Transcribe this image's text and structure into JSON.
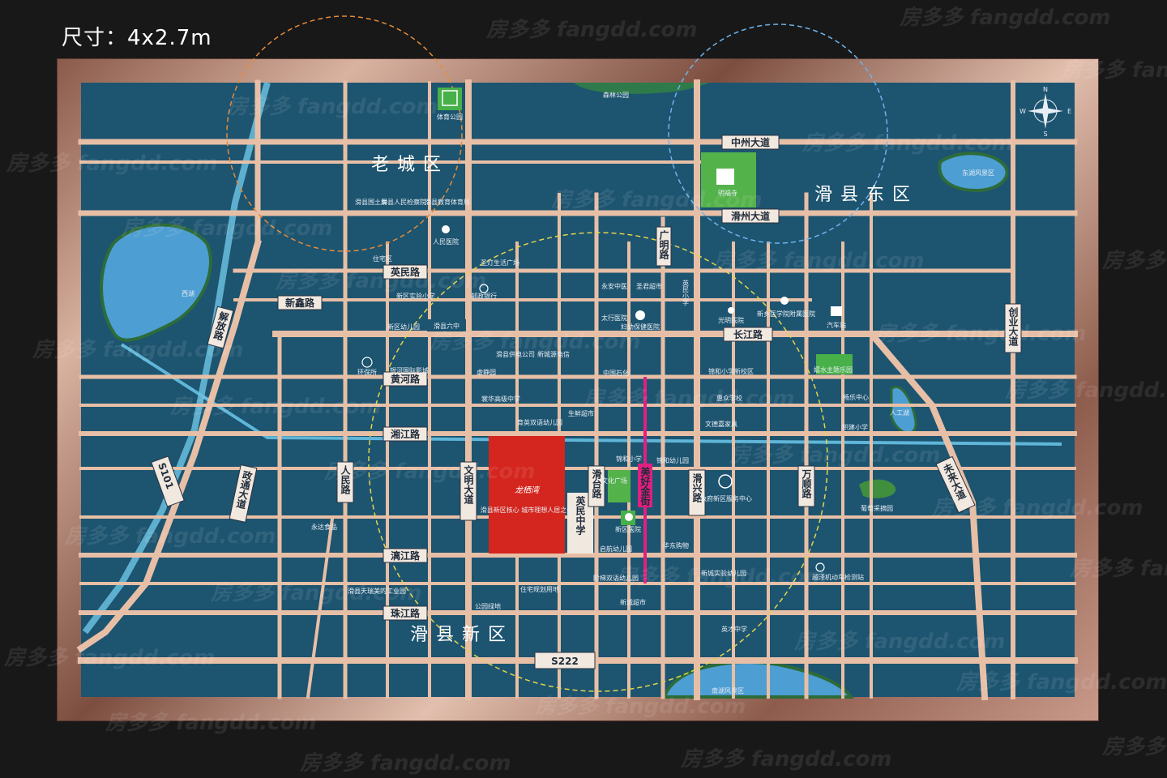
{
  "size_label": "尺寸：4x2.7m",
  "districts": {
    "old_city": "老城区",
    "east": "滑县东区",
    "new": "滑县新区"
  },
  "project": {
    "name": "龙栖湾",
    "tagline": "滑县新区核心 城市理想人居之作",
    "color": "#d4261e"
  },
  "roads": {
    "zhongzhou": "中州大道",
    "huazhou": "滑州大道",
    "yingmin": "英民路",
    "xinxin": "新鑫路",
    "huaxian6": "滑县六中",
    "changjiang": "长江路",
    "huanghe": "黄河路",
    "xiangjiang": "湘江路",
    "lijiang": "漓江路",
    "zhujiang": "珠江路",
    "s222": "S222",
    "s101": "S101",
    "jiefang": "解放路",
    "zhengtong": "政通大道",
    "renmin": "人民路",
    "wenming": "文明大道",
    "huatai": "滑台路",
    "meihao": "美好金街",
    "huaxing": "滑兴路",
    "wanshun": "万顺路",
    "guangming": "广明路",
    "chuangye": "创业大道",
    "weilai": "未来大道",
    "yingminzx": "英民中学",
    "yingmin_xiaoxue": "英民小学"
  },
  "pois": {
    "sports_park": "体育公园",
    "forest_park": "森林公园",
    "mingfu_temple": "明福寺",
    "donghu": "东湖风景区",
    "xihu": "西湖",
    "nanhu": "南湖风景区",
    "land_bureau": "滑县国土局",
    "court": "滑县人民检察院",
    "edu_bureau": "滑县教育体育局",
    "hospital": "人民医院",
    "plaza": "圣灯生活广场",
    "residential": "住宅区",
    "experimental_school": "新区实验小学",
    "bank": "邮政银行",
    "kindergarten": "新区幼儿园",
    "yongan": "永安中医",
    "shengjun": "圣君超市",
    "taihang": "太行医院",
    "maternal": "妇幼保健医院",
    "guangming_hosp": "光明医院",
    "village_med": "新乡医学院附属医院",
    "bus_station": "汽车站",
    "zhongguo_petro": "中国石化",
    "water_park": "嬉水主题乐园",
    "jinhe_new": "锦和小学新校区",
    "huanbao": "环保所",
    "yinhe": "银河国际影城",
    "power": "滑县供电公司",
    "xinyuan": "新城源电信",
    "xujing": "虚静园",
    "yuhua": "裳华高级中学",
    "yuying": "育英双语幼儿园",
    "shengxian": "生鲜超市",
    "jinhe": "锦和小学",
    "jinhe_kg": "锦和幼儿园",
    "culture_plaza": "文化广场",
    "gov": "政府新区服务中心",
    "xinqu_hosp": "新区医院",
    "qihang": "启航幼儿园",
    "huadong": "华东购物",
    "huizhi": "惠众学校",
    "wendao": "文德嘉家具",
    "yongda": "永达食品",
    "industry": "滑县天瑞美的工业园",
    "park": "公园绿地",
    "plan": "住宅规划用地",
    "jieti": "阶梯双语幼儿园",
    "xincheng_market": "新城超市",
    "xincheng_kg": "新城实验幼儿园",
    "yingcai": "英才中学",
    "car_test": "越泽机动车检测站",
    "rengong": "人工湖",
    "putao": "葡萄采摘园",
    "jixin": "积建小学",
    "changle": "畅乐中心"
  },
  "compass": {
    "n": "N",
    "s": "S",
    "e": "E",
    "w": "W"
  },
  "watermark": "房多多 fangdd.com"
}
